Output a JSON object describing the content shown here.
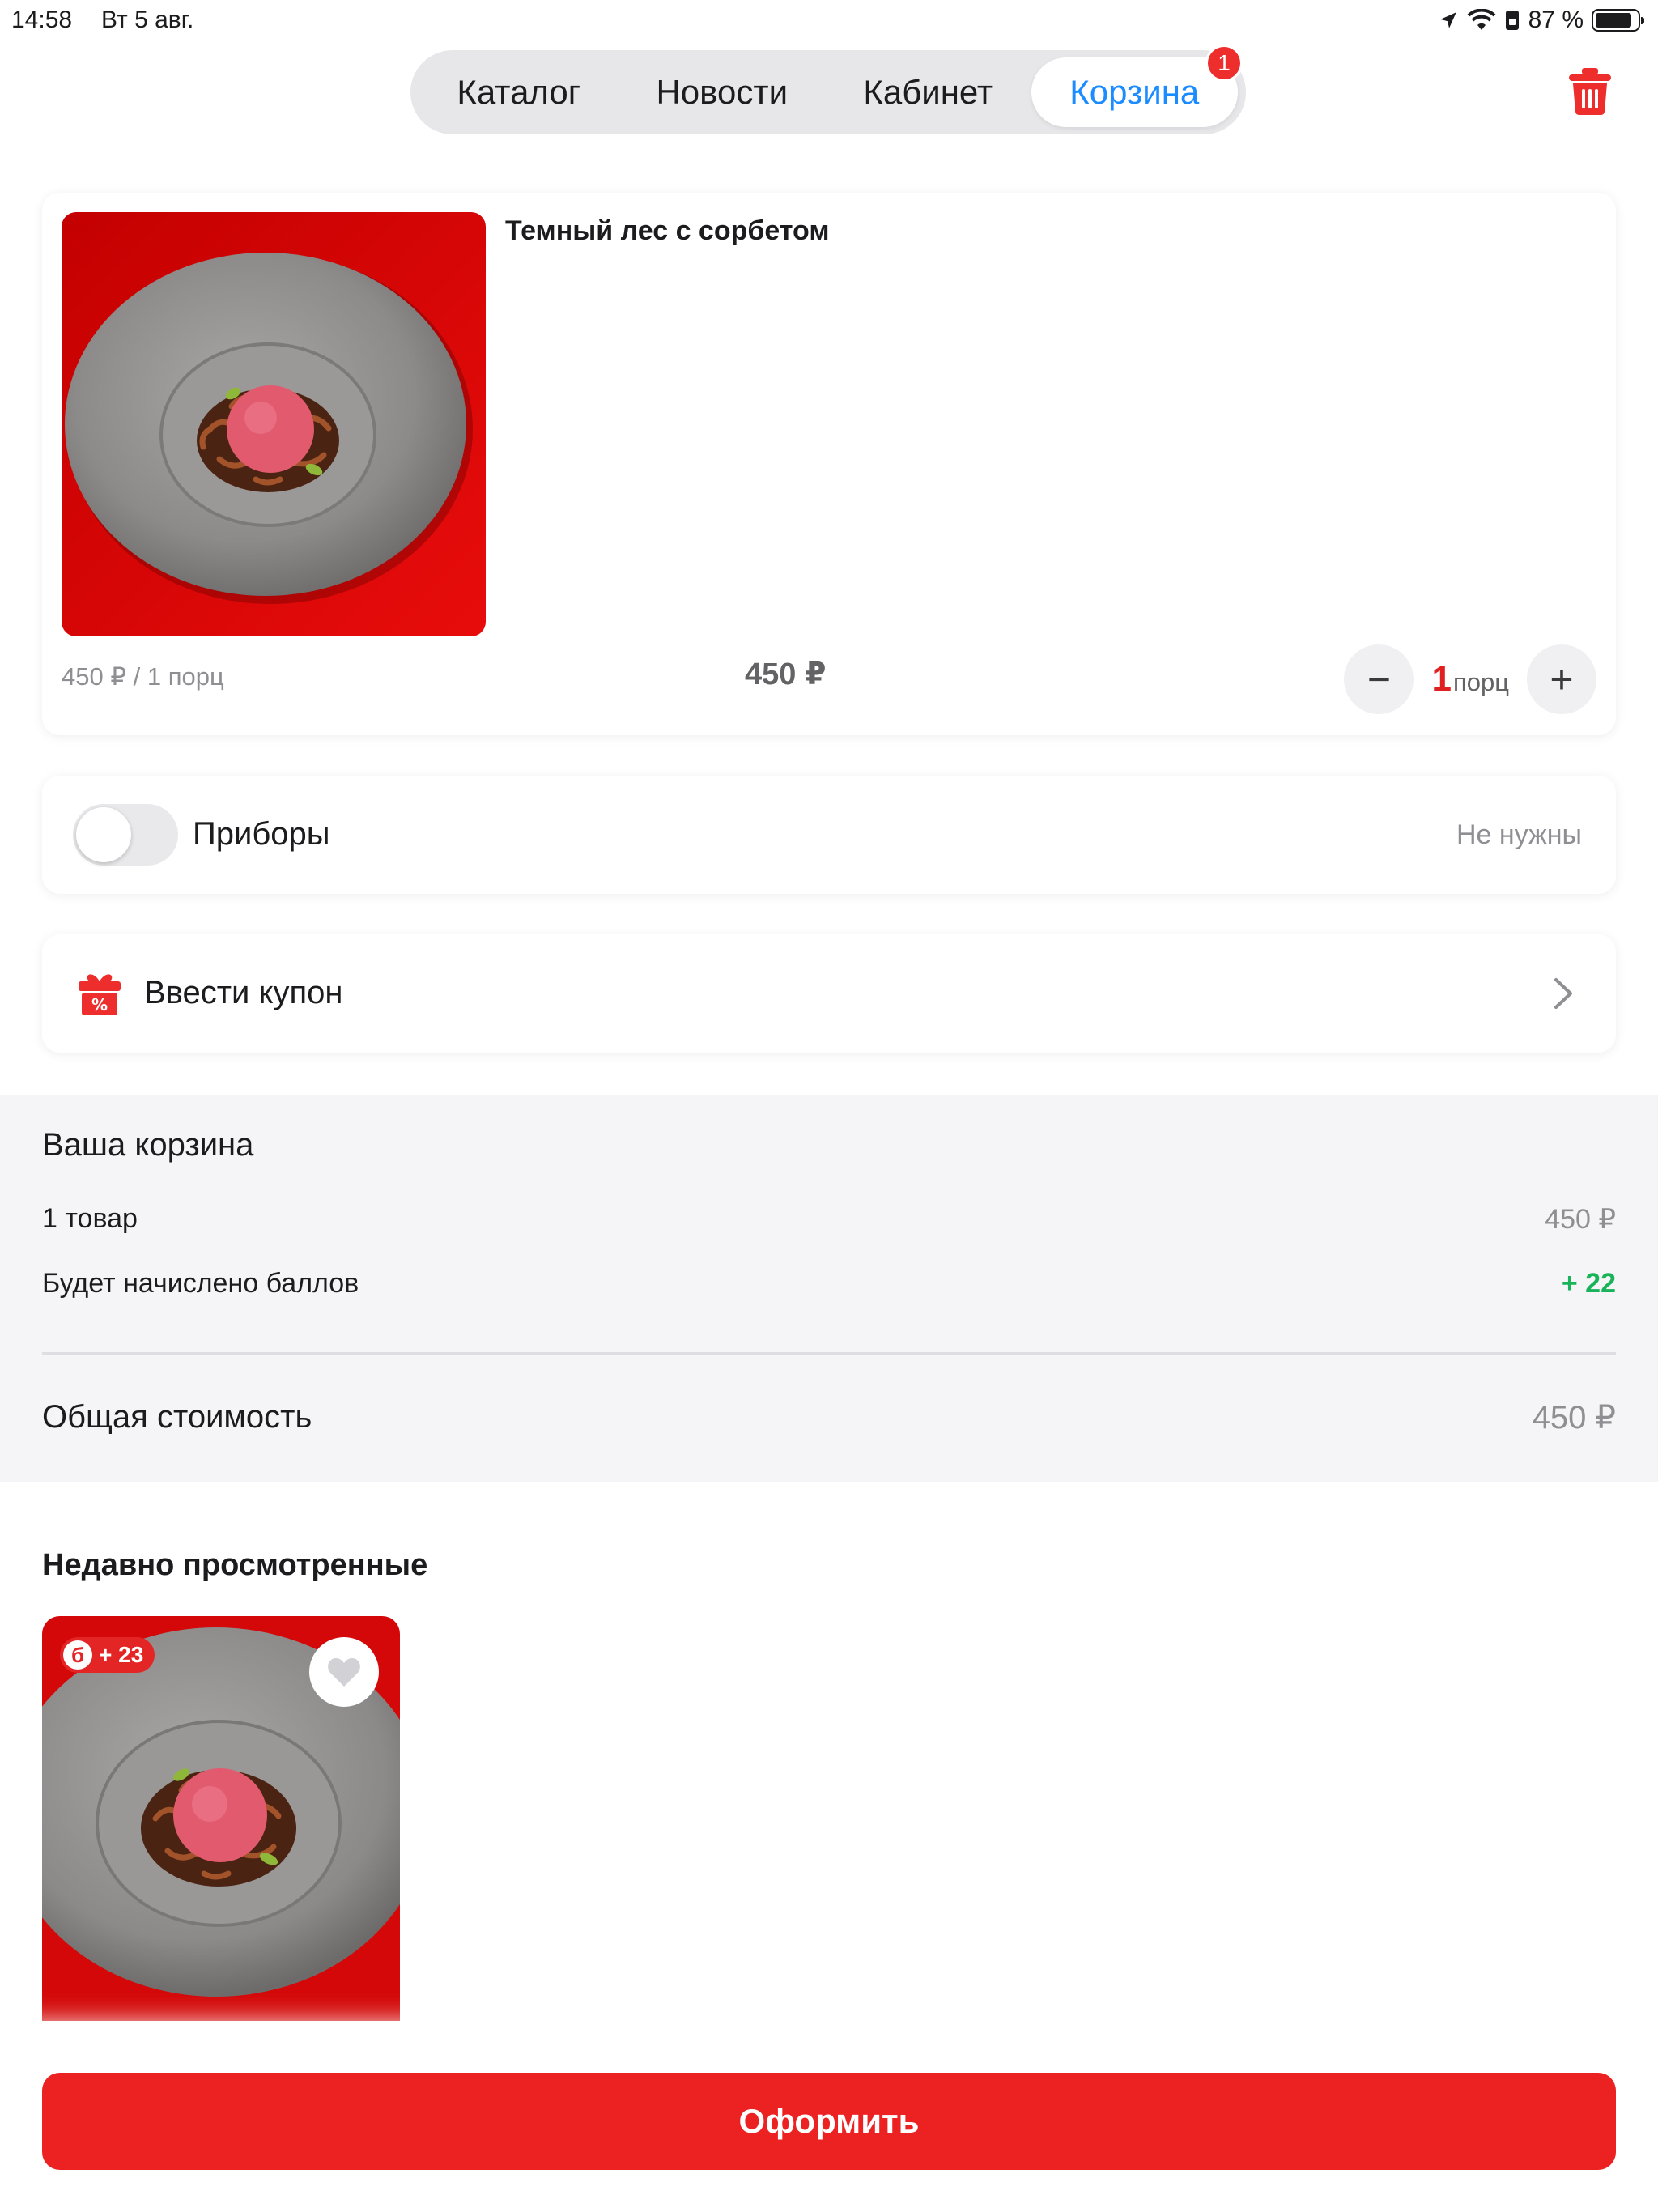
{
  "status_bar": {
    "time": "14:58",
    "date": "Вт 5 авг.",
    "battery": "87 %",
    "battery_level": 0.87
  },
  "nav": {
    "tabs": [
      {
        "label": "Каталог"
      },
      {
        "label": "Новости"
      },
      {
        "label": "Кабинет"
      },
      {
        "label": "Корзина",
        "badge": "1",
        "active": true
      }
    ],
    "accent_color": "#1a8cff",
    "badge_color": "#ee2d2d"
  },
  "cart_item": {
    "name": "Темный лес с сорбетом",
    "unit_price": "450 ₽ / 1 порц",
    "total_price": "450 ₽",
    "qty_value": "1",
    "qty_unit": "порц",
    "minus": "−",
    "plus": "+"
  },
  "cutlery": {
    "label": "Приборы",
    "status": "Не нужны",
    "enabled": false
  },
  "coupon": {
    "label": "Ввести купон"
  },
  "summary": {
    "title": "Ваша корзина",
    "items_label": "1 товар",
    "items_value": "450 ₽",
    "points_label": "Будет начислено баллов",
    "points_value": "+ 22",
    "total_label": "Общая стоимость",
    "total_value": "450 ₽",
    "points_color": "#19b35a"
  },
  "recent": {
    "title": "Недавно просмотренные",
    "items": [
      {
        "bonus_icon": "б",
        "bonus": "+ 23",
        "favorite": false
      }
    ]
  },
  "checkout": {
    "label": "Оформить",
    "color": "#ec2222"
  },
  "icons": {
    "trash": "trash-icon",
    "gift": "gift-icon",
    "chevron": "chevron-right-icon",
    "heart": "heart-icon"
  }
}
